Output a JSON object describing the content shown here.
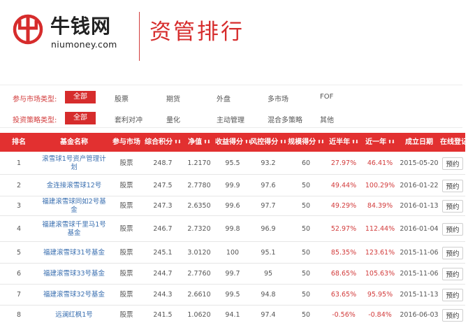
{
  "header": {
    "logo_cn": "牛钱网",
    "logo_en": "niumoney.com",
    "title": "资管排行"
  },
  "filters": {
    "market": {
      "label": "参与市场类型:",
      "options": [
        "全部",
        "股票",
        "期货",
        "外盘",
        "多市场",
        "FOF"
      ],
      "selected": "全部"
    },
    "strategy": {
      "label": "投资策略类型:",
      "options": [
        "全部",
        "套利对冲",
        "量化",
        "主动管理",
        "混合多策略",
        "其他"
      ],
      "selected": "全部"
    }
  },
  "table": {
    "columns": [
      "排名",
      "基金名称",
      "参与市场",
      "综合积分",
      "净值",
      "收益得分",
      "风控得分",
      "规模得分",
      "近半年",
      "近一年",
      "成立日期",
      "在线登记"
    ],
    "sortable": [
      false,
      false,
      false,
      true,
      true,
      true,
      true,
      true,
      true,
      true,
      false,
      false
    ],
    "sort_glyph": "⬆⬇",
    "rows": [
      {
        "rank": "1",
        "name": "滚雪球1号资产管理计划",
        "market": "股票",
        "score": "248.7",
        "nav": "1.2170",
        "ret_score": "95.5",
        "risk_score": "93.2",
        "size_score": "60",
        "half_year": "27.97%",
        "one_year": "46.41%",
        "date": "2015-05-20",
        "action": "预约"
      },
      {
        "rank": "2",
        "name": "金连接滚雪球12号",
        "market": "股票",
        "score": "247.5",
        "nav": "2.7780",
        "ret_score": "99.9",
        "risk_score": "97.6",
        "size_score": "50",
        "half_year": "49.44%",
        "one_year": "100.29%",
        "date": "2016-01-22",
        "action": "预约"
      },
      {
        "rank": "3",
        "name": "福建滚雪球同如2号基金",
        "market": "股票",
        "score": "247.3",
        "nav": "2.6350",
        "ret_score": "99.6",
        "risk_score": "97.7",
        "size_score": "50",
        "half_year": "49.29%",
        "one_year": "84.39%",
        "date": "2016-01-13",
        "action": "预约"
      },
      {
        "rank": "4",
        "name": "福建滚雪球千里马1号基金",
        "market": "股票",
        "score": "246.7",
        "nav": "2.7320",
        "ret_score": "99.8",
        "risk_score": "96.9",
        "size_score": "50",
        "half_year": "52.97%",
        "one_year": "112.44%",
        "date": "2016-01-04",
        "action": "预约"
      },
      {
        "rank": "5",
        "name": "福建滚雪球31号基金",
        "market": "股票",
        "score": "245.1",
        "nav": "3.0120",
        "ret_score": "100",
        "risk_score": "95.1",
        "size_score": "50",
        "half_year": "85.35%",
        "one_year": "123.61%",
        "date": "2015-11-06",
        "action": "预约"
      },
      {
        "rank": "6",
        "name": "福建滚雪球33号基金",
        "market": "股票",
        "score": "244.7",
        "nav": "2.7760",
        "ret_score": "99.7",
        "risk_score": "95",
        "size_score": "50",
        "half_year": "68.65%",
        "one_year": "105.63%",
        "date": "2015-11-06",
        "action": "预约"
      },
      {
        "rank": "7",
        "name": "福建滚雪球32号基金",
        "market": "股票",
        "score": "244.3",
        "nav": "2.6610",
        "ret_score": "99.5",
        "risk_score": "94.8",
        "size_score": "50",
        "half_year": "63.65%",
        "one_year": "95.95%",
        "date": "2015-11-13",
        "action": "预约"
      },
      {
        "rank": "8",
        "name": "远澜红枫1号",
        "market": "股票",
        "score": "241.5",
        "nav": "1.0620",
        "ret_score": "94.1",
        "risk_score": "97.4",
        "size_score": "50",
        "half_year": "-0.56%",
        "one_year": "-0.84%",
        "date": "2016-06-03",
        "action": "预约"
      }
    ]
  },
  "colors": {
    "accent": "#d62c2c",
    "header_row": "#e23030",
    "link": "#3a6fb0"
  }
}
